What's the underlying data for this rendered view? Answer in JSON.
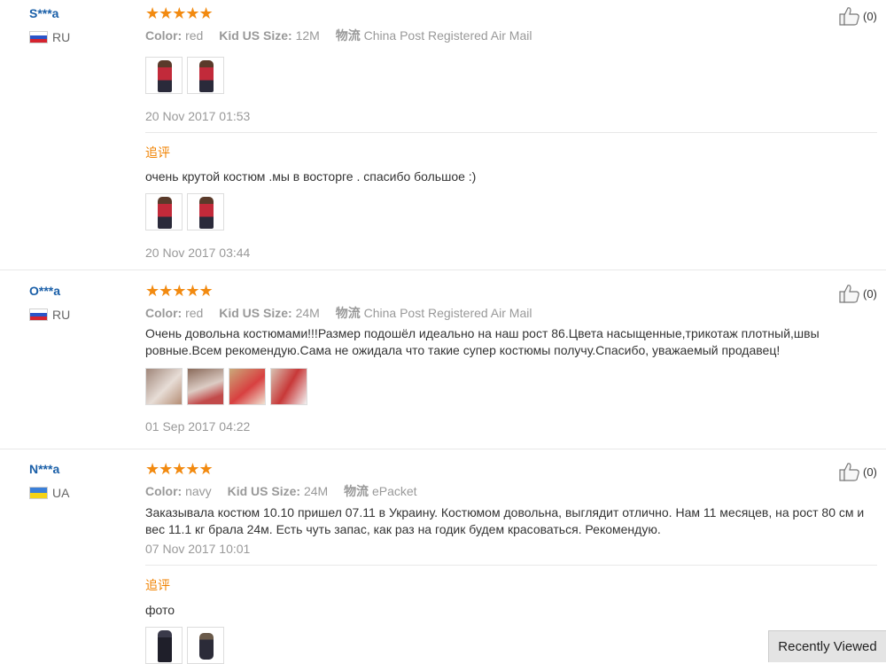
{
  "reviews": [
    {
      "user": "S***a",
      "country": "RU",
      "stars": "★★★★★",
      "attributes": [
        {
          "label": "Color:",
          "value": "red"
        },
        {
          "label": "Kid US Size:",
          "value": "12M"
        },
        {
          "label": "物流",
          "value": "China Post Registered Air Mail"
        }
      ],
      "date": "20 Nov 2017 01:53",
      "likes": "(0)",
      "followup": {
        "label": "追评",
        "text": "очень крутой костюм .мы в восторге . спасибо большое :)",
        "date": "20 Nov 2017 03:44"
      }
    },
    {
      "user": "O***a",
      "country": "RU",
      "stars": "★★★★★",
      "attributes": [
        {
          "label": "Color:",
          "value": "red"
        },
        {
          "label": "Kid US Size:",
          "value": "24M"
        },
        {
          "label": "物流",
          "value": "China Post Registered Air Mail"
        }
      ],
      "text": "Очень довольна костюмами!!!Размер подошёл идеально на наш рост 86.Цвета насыщенные,трикотаж плотный,швы ровные.Всем рекомендую.Сама не ожидала что такие супер костюмы получу.Спасибо, уважаемый продавец!",
      "date": "01 Sep 2017 04:22",
      "likes": "(0)"
    },
    {
      "user": "N***a",
      "country": "UA",
      "stars": "★★★★★",
      "attributes": [
        {
          "label": "Color:",
          "value": "navy"
        },
        {
          "label": "Kid US Size:",
          "value": "24M"
        },
        {
          "label": "物流",
          "value": "ePacket"
        }
      ],
      "text": "Заказывала костюм 10.10 пришел 07.11 в Украину. Костюмом довольна, выглядит отлично. Нам 11 месяцев, на рост 80 см и вес 11.1 кг брала 24м. Есть чуть запас, как раз на годик будем красоваться. Рекомендую.",
      "date": "07 Nov 2017 10:01",
      "likes": "(0)",
      "followup": {
        "label": "追评",
        "text": "фото"
      }
    }
  ],
  "recently_viewed": "Recently Viewed",
  "colors": {
    "user_link": "#1a5fa8",
    "stars": "#f28a10",
    "followup_label": "#f08200",
    "muted": "#999999"
  }
}
